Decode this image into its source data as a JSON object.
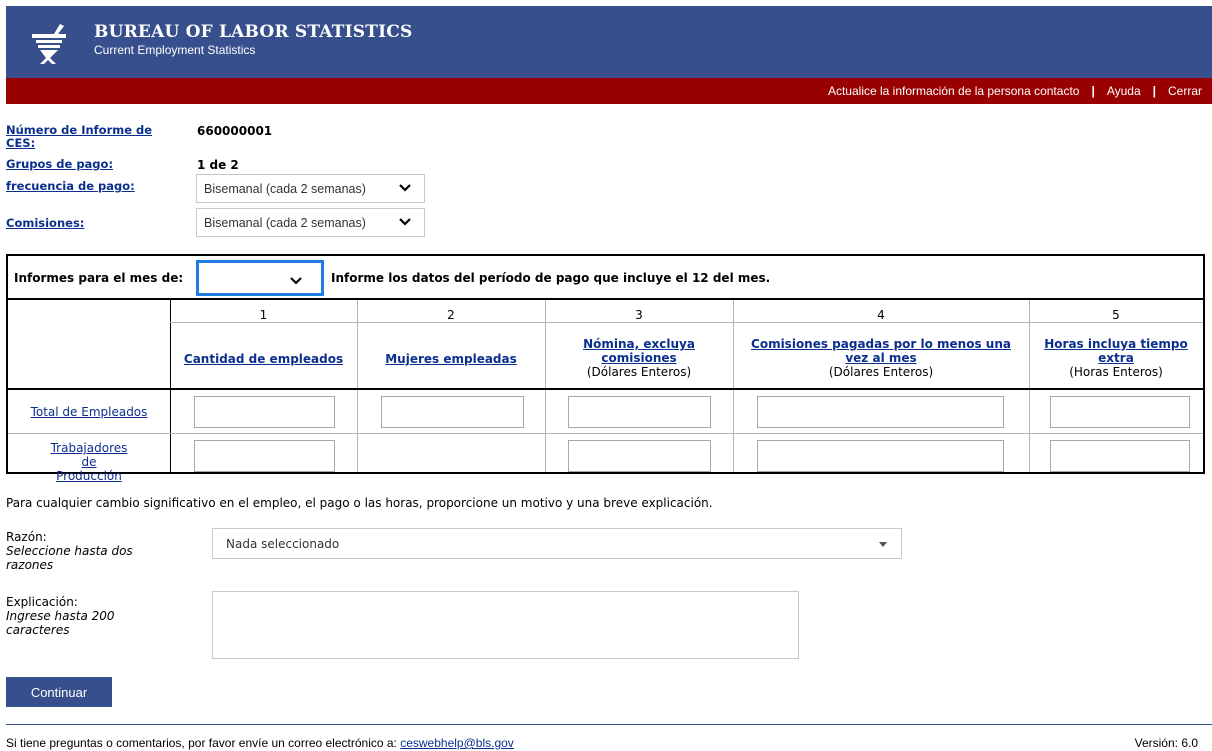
{
  "header": {
    "title": "BUREAU OF LABOR STATISTICS",
    "subtitle": "Current Employment Statistics",
    "colors": {
      "header_bg": "#37508d",
      "nav_bg": "#990000",
      "link": "#0b2f8e"
    },
    "logo_icon": "bls-logo-icon"
  },
  "nav": {
    "update_contact": "Actualice la información de la persona contacto",
    "separator": "|",
    "help": "Ayuda",
    "close": "Cerrar"
  },
  "report_info": {
    "report_number_label": "Número de Informe de CES:",
    "report_number_value": "660000001",
    "pay_groups_label": "Grupos de pago:",
    "pay_groups_value": "1 de 2",
    "pay_frequency_label": "frecuencia de pago:",
    "pay_frequency_value": "Bisemanal (cada 2 semanas)",
    "commissions_label": "Comisiones:",
    "commissions_value": "Bisemanal (cada 2 semanas)"
  },
  "month": {
    "label": "Informes para el mes de:",
    "selected": "",
    "note": "Informe los datos del período de pago que incluye el 12 del mes."
  },
  "table": {
    "columns": [
      {
        "number": "1",
        "title": "Cantidad de empleados",
        "unit": ""
      },
      {
        "number": "2",
        "title": "Mujeres empleadas",
        "unit": ""
      },
      {
        "number": "3",
        "title": "Nómina, excluya comisiones",
        "unit": "(Dólares Enteros)"
      },
      {
        "number": "4",
        "title": "Comisiones pagadas por lo menos una vez al mes",
        "unit": "(Dólares Enteros)"
      },
      {
        "number": "5",
        "title": "Horas incluya tiempo extra",
        "unit": "(Horas Enteros)"
      }
    ],
    "rows": [
      {
        "label": "Total de Empleados"
      },
      {
        "label": "Trabajadores de Producción"
      }
    ]
  },
  "instruction": "Para cualquier cambio significativo en el empleo, el pago o las horas, proporcione un motivo y una breve explicación.",
  "reason": {
    "label": "Razón:",
    "hint": "Seleccione hasta dos razones",
    "selected": "Nada seleccionado"
  },
  "explanation": {
    "label": "Explicación:",
    "hint": "Ingrese hasta 200 caracteres",
    "value": ""
  },
  "continue_button": "Continuar",
  "footer": {
    "text": "Si tiene preguntas o comentarios, por favor envíe un correo electrónico a: ",
    "email": "ceswebhelp@bls.gov",
    "version": "Versión: 6.0"
  }
}
